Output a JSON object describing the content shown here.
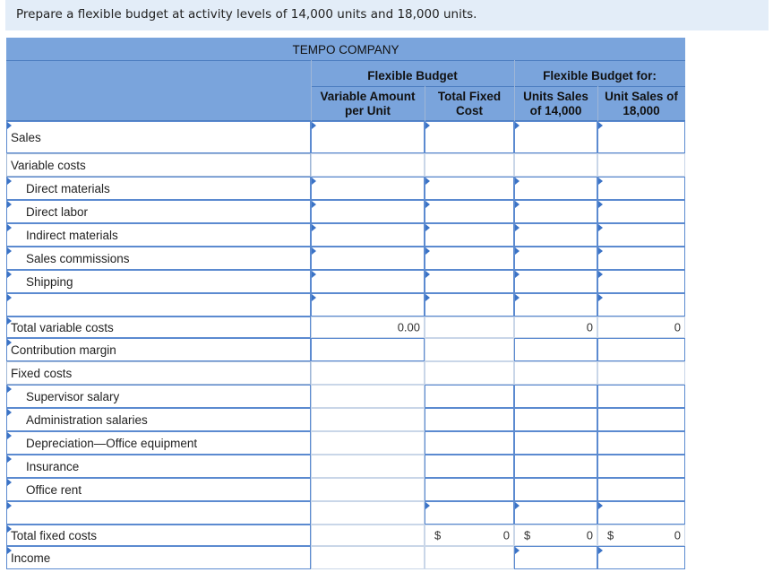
{
  "instruction": "Prepare a flexible budget at activity levels of 14,000 units and 18,000 units.",
  "company": "TEMPO COMPANY",
  "headers": {
    "flexible_budget": "Flexible Budget",
    "flexible_budget_for": "Flexible Budget for:",
    "col1_line1": "Variable Amount",
    "col1_line2": "per Unit",
    "col2_line1": "Total Fixed",
    "col2_line2": "Cost",
    "col3_line1": "Units Sales",
    "col3_line2": "of 14,000",
    "col4_line1": "Unit Sales of",
    "col4_line2": "18,000"
  },
  "rows": {
    "sales": "Sales",
    "variable_costs": "Variable costs",
    "direct_materials": "Direct materials",
    "direct_labor": "Direct labor",
    "indirect_materials": "Indirect materials",
    "sales_commissions": "Sales commissions",
    "shipping": "Shipping",
    "total_variable_costs": "Total variable costs",
    "contribution_margin": "Contribution margin",
    "fixed_costs": "Fixed costs",
    "supervisor_salary": "Supervisor salary",
    "administration_salaries": "Administration salaries",
    "depreciation": "Depreciation—Office equipment",
    "insurance": "Insurance",
    "office_rent": "Office rent",
    "total_fixed_costs": "Total fixed costs",
    "income": "Income"
  },
  "values": {
    "tvc_col1": "0.00",
    "tvc_col3": "0",
    "tvc_col4": "0",
    "tfc_col2": "0",
    "tfc_col3": "0",
    "tfc_col4": "0",
    "dollar": "$"
  }
}
